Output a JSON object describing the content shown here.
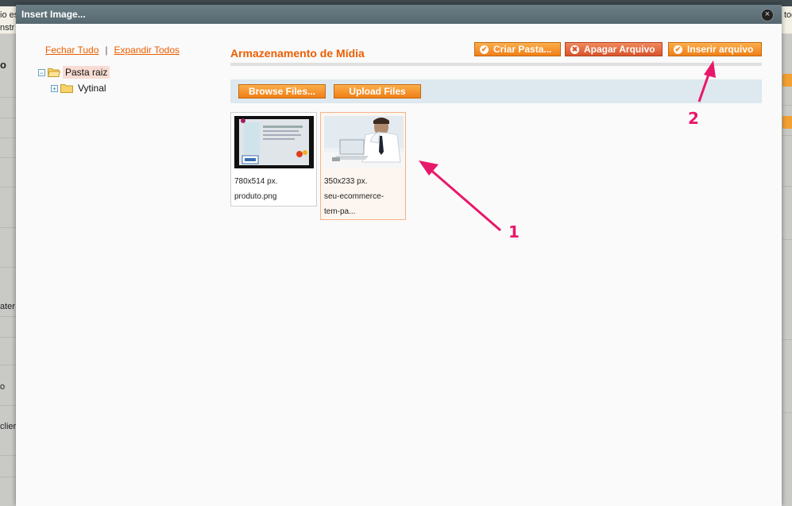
{
  "backdrop": {
    "texts": [
      {
        "id": "t1",
        "text": "io es"
      },
      {
        "id": "t2",
        "text": "nstr"
      },
      {
        "id": "t3",
        "text": "o"
      },
      {
        "id": "t4",
        "text": "ater"
      },
      {
        "id": "t5",
        "text": "o"
      },
      {
        "id": "t6",
        "text": "clier"
      },
      {
        "id": "t7",
        "text": "toq"
      },
      {
        "id": "t8",
        "text": "Iva"
      }
    ]
  },
  "dialog": {
    "title": "Insert Image...",
    "close_label": "×"
  },
  "tree": {
    "collapse_all": "Fechar Tudo",
    "separator": "|",
    "expand_all": "Expandir Todos",
    "nodes": [
      {
        "label": "Pasta raiz",
        "expander": "−",
        "selected": true
      },
      {
        "label": "Vytinal",
        "expander": "+",
        "selected": false
      }
    ]
  },
  "main": {
    "title": "Armazenamento de Mídia",
    "buttons": {
      "create_folder": "Criar Pasta...",
      "delete_file": "Apagar Arquivo",
      "insert_file": "Inserir arquivo",
      "browse_files": "Browse Files...",
      "upload_files": "Upload Files"
    },
    "files": [
      {
        "dimensions": "780x514 px.",
        "name": "produto.png",
        "selected": false
      },
      {
        "dimensions": "350x233 px.",
        "name_line1": "seu-ecommerce-",
        "name_line2": "tem-pa...",
        "selected": true
      }
    ]
  },
  "annotations": {
    "arrow1_label": "1",
    "arrow2_label": "2",
    "color": "#e8186a"
  },
  "colors": {
    "accent": "#eb5e00",
    "button_orange": "#f07f17",
    "button_delete": "#d9532b",
    "header": "#5e7178"
  }
}
